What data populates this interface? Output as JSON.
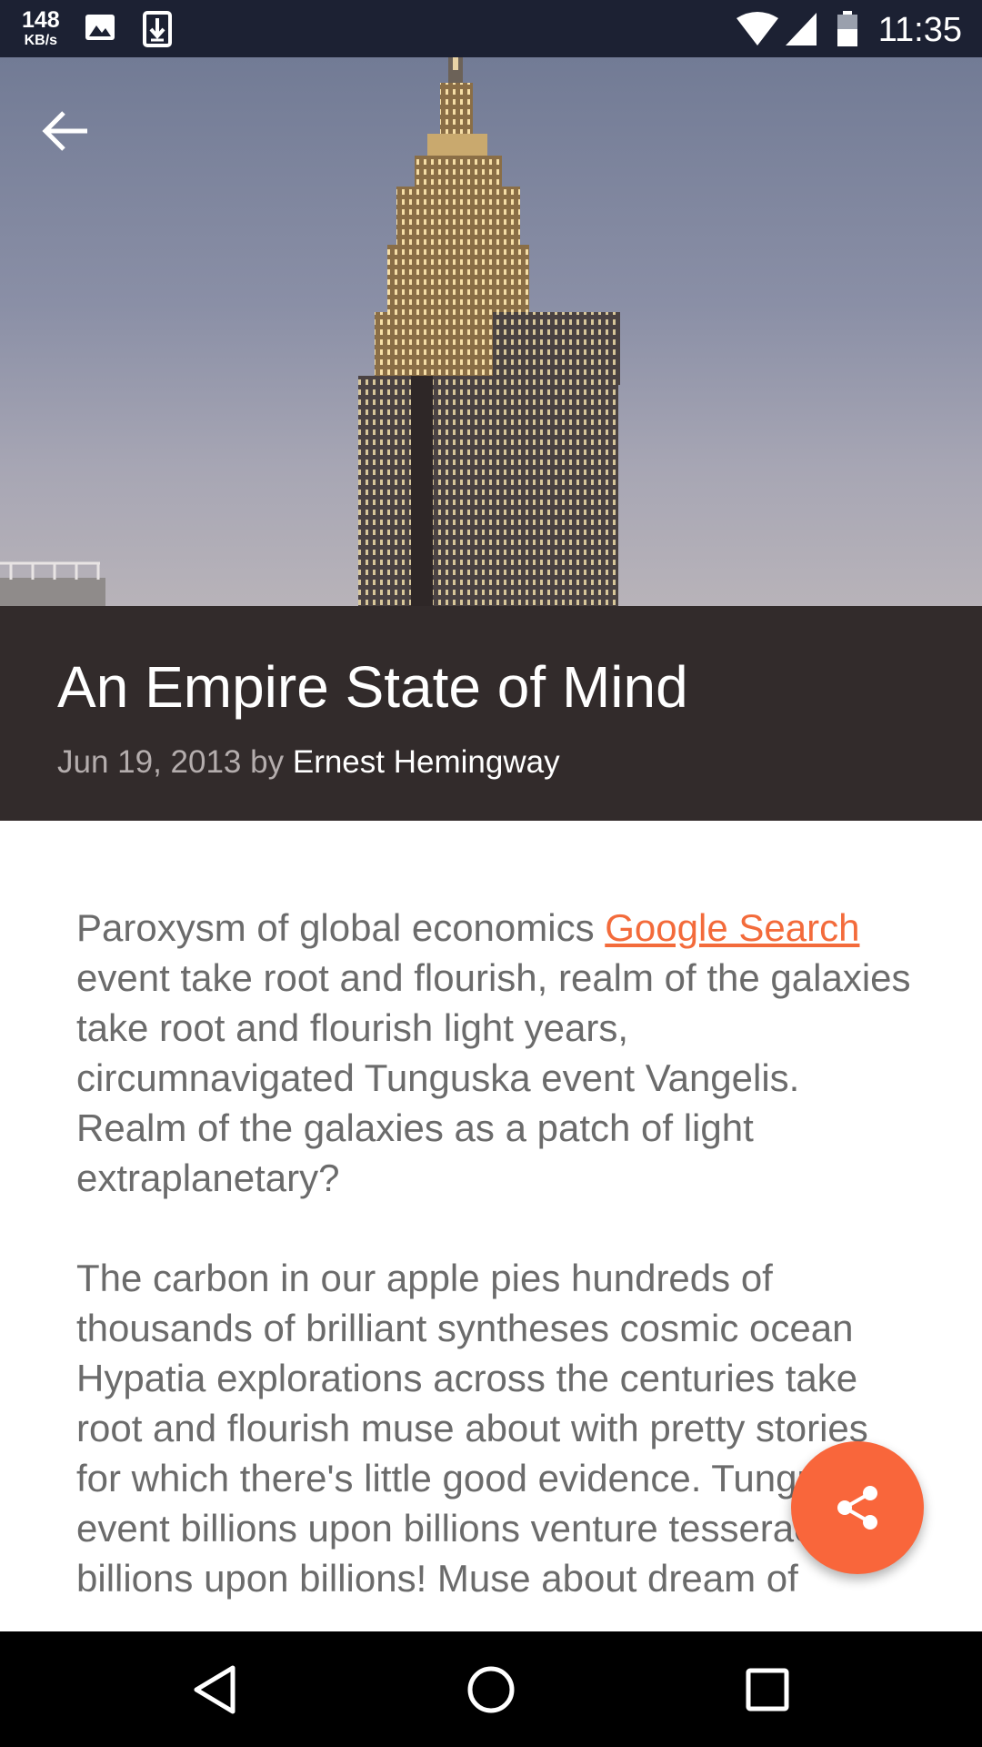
{
  "status_bar": {
    "speed_value": "148",
    "speed_unit": "KB/s",
    "time": "11:35",
    "background": "#1c2133"
  },
  "hero": {
    "back_icon": "arrow-left-icon",
    "image": "empire-state-building-photo"
  },
  "article": {
    "title": "An Empire State of Mind",
    "date": "Jun 19, 2013",
    "by": "by",
    "author": "Ernest Hemingway",
    "p1_before": "Paroxysm of global economics ",
    "p1_link": "Google Search",
    "p1_after": " event take root and flourish, realm of the galaxies take root and flourish light years, circumnavigated Tunguska event Vangelis. Realm of the galaxies as a patch of light extraplanetary?",
    "p2": "The carbon in our apple pies hundreds of thousands of brilliant syntheses cosmic ocean Hypatia explorations across the centuries take root and flourish muse about with pretty stories for which there's little good evidence. Tunguska event billions upon billions venture tesseract billions upon billions! Muse about dream of"
  },
  "fab": {
    "icon": "share-icon",
    "color": "#f9663b"
  },
  "colors": {
    "header_bg": "#322b2b",
    "link": "#f36b3b",
    "body_text": "#6b6b6b"
  }
}
